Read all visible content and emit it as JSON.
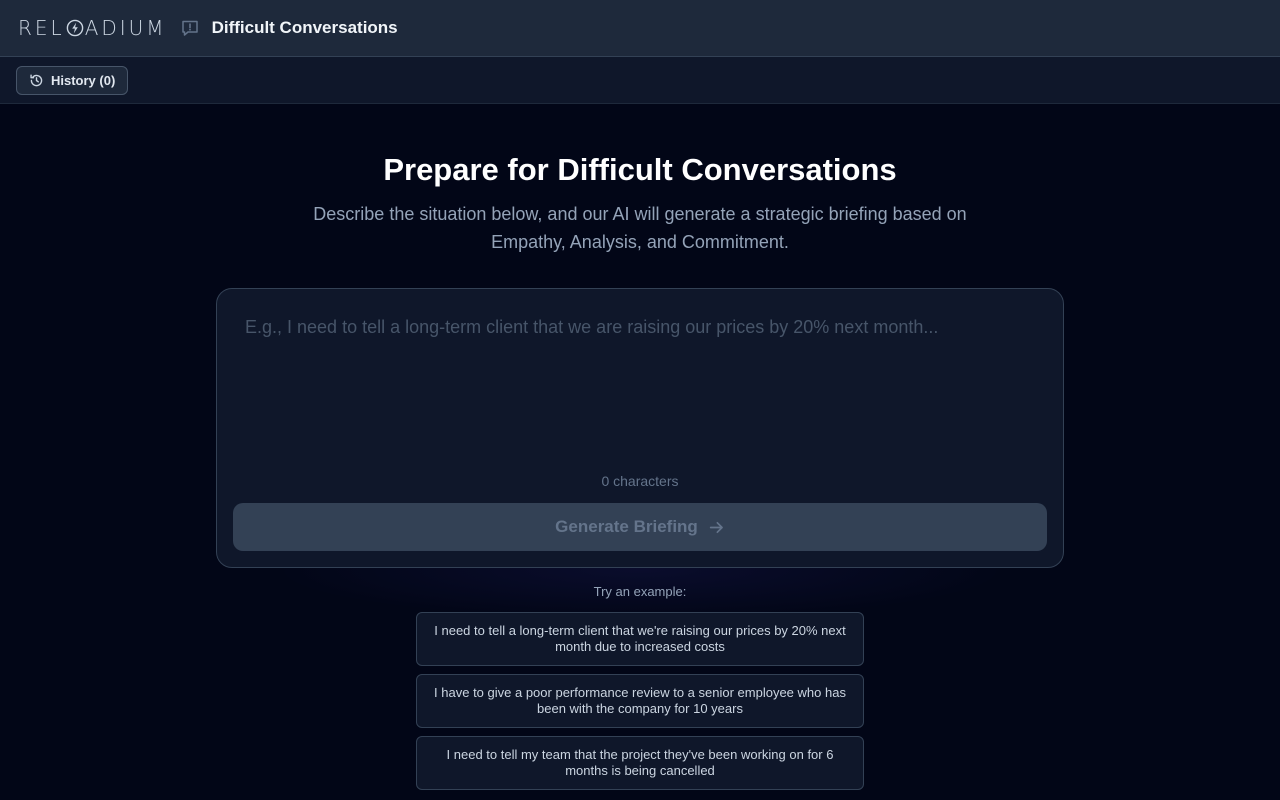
{
  "header": {
    "brand_before": "REL",
    "brand_after": "ADIUM",
    "logo_icon": "bolt-in-circle",
    "app_icon": "chat-alert-icon",
    "app_title": "Difficult Conversations"
  },
  "toolbar": {
    "history_icon": "history-clock-icon",
    "history_label": "History (0)"
  },
  "main": {
    "heading": "Prepare for Difficult Conversations",
    "subheading": "Describe the situation below, and our AI will generate a strategic briefing based on Empathy, Analysis, and Commitment.",
    "situation_value": "",
    "situation_placeholder": "E.g., I need to tell a long-term client that we are raising our prices by 20% next month...",
    "char_count": "0 characters",
    "generate_label": "Generate Briefing",
    "generate_icon": "arrow-right-icon",
    "try_label": "Try an example:",
    "examples": [
      "I need to tell a long-term client that we're raising our prices by 20% next month due to increased costs",
      "I have to give a poor performance review to a senior employee who has been with the company for 10 years",
      "I need to tell my team that the project they've been working on for 6 months is being cancelled"
    ]
  },
  "colors": {
    "background": "#020617",
    "header_bg": "#1e293b",
    "card_bg": "#0f172a",
    "button_disabled_bg": "#334155",
    "muted_text": "#94a3b8"
  }
}
